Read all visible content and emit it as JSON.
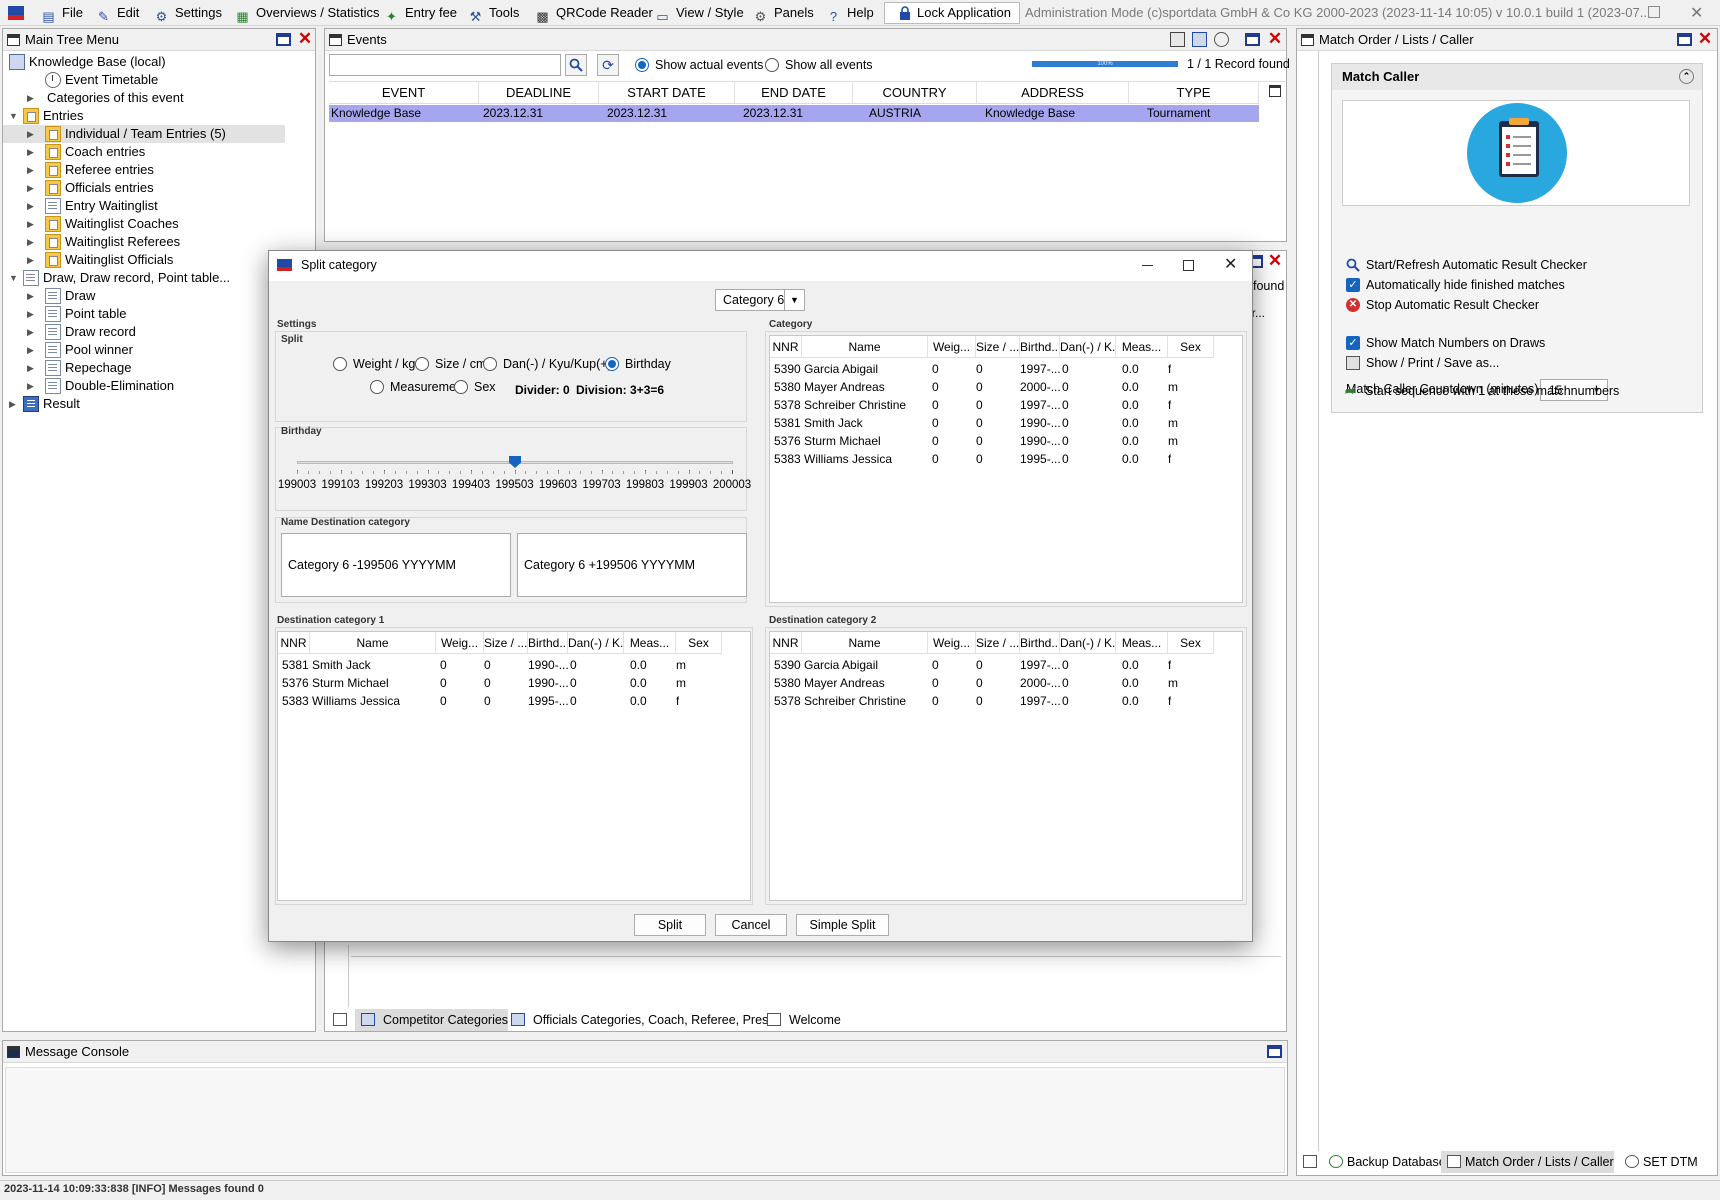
{
  "menu": {
    "items": [
      {
        "label": "File",
        "icon": "file-icon"
      },
      {
        "label": "Edit",
        "icon": "edit-icon"
      },
      {
        "label": "Settings",
        "icon": "gear-icon"
      },
      {
        "label": "Overviews / Statistics",
        "icon": "statistics-icon"
      },
      {
        "label": "Entry fee",
        "icon": "money-icon"
      },
      {
        "label": "Tools",
        "icon": "wrench-icon"
      },
      {
        "label": "QRCode Reader",
        "icon": "qrcode-icon"
      },
      {
        "label": "View / Style",
        "icon": "view-icon"
      },
      {
        "label": "Panels",
        "icon": "panels-icon"
      },
      {
        "label": "Help",
        "icon": "help-icon"
      }
    ],
    "lock_label": "Lock Application",
    "admin_text": "Administration Mode (c)sportdata GmbH & Co KG 2000-2023 (2023-11-14 10:05)  v 10.0.1 build 1 (2023-07..."
  },
  "tree": {
    "title": "Main Tree Menu",
    "items": [
      {
        "label": "Knowledge Base (local)",
        "icon": "kb"
      },
      {
        "label": "Event Timetable",
        "icon": "clock"
      },
      {
        "label": "Categories of this event",
        "icon": ""
      },
      {
        "label": "Entries",
        "icon": "folder"
      },
      {
        "label": "Individual / Team Entries (5)",
        "icon": "folder"
      },
      {
        "label": "Coach entries",
        "icon": "folder"
      },
      {
        "label": "Referee entries",
        "icon": "folder"
      },
      {
        "label": "Officials entries",
        "icon": "folder"
      },
      {
        "label": "Entry Waitinglist",
        "icon": "doc"
      },
      {
        "label": "Waitinglist Coaches",
        "icon": "folder"
      },
      {
        "label": "Waitinglist Referees",
        "icon": "folder"
      },
      {
        "label": "Waitinglist Officials",
        "icon": "folder"
      },
      {
        "label": "Draw, Draw record, Point table...",
        "icon": "doc"
      },
      {
        "label": "Draw",
        "icon": "doc"
      },
      {
        "label": "Point table",
        "icon": "doc"
      },
      {
        "label": "Draw record",
        "icon": "doc"
      },
      {
        "label": "Pool winner",
        "icon": "doc"
      },
      {
        "label": "Repechage",
        "icon": "doc"
      },
      {
        "label": "Double-Elimination",
        "icon": "doc"
      },
      {
        "label": "Result",
        "icon": "res"
      }
    ]
  },
  "events": {
    "title": "Events",
    "search_value": "",
    "radio_actual": "Show actual events",
    "radio_all": "Show all events",
    "progress_label": "100%",
    "progress": 1.0,
    "record_count": "1 / 1 Record found",
    "columns": [
      "EVENT",
      "DEADLINE",
      "START DATE",
      "END DATE",
      "COUNTRY",
      "ADDRESS",
      "TYPE"
    ],
    "rows": [
      [
        "Knowledge Base",
        "2023.12.31",
        "2023.12.31",
        "2023.12.31",
        "AUSTRIA",
        "Knowledge Base",
        "Tournament"
      ]
    ]
  },
  "second_panel": {
    "record_fragment": "found",
    "col_fragment": "or..."
  },
  "dialog": {
    "title": "Split category",
    "category_select": "Category 6",
    "settings_label": "Settings",
    "split_label": "Split",
    "split_options": [
      "Weight / kg",
      "Size / cm",
      "Dan(-) / Kyu/Kup(+)",
      "Birthday",
      "Measurement",
      "Sex"
    ],
    "selected_option": "Birthday",
    "divider_text": "Divider: 0",
    "division_text": "Division: 3+3=6",
    "birthday_label": "Birthday",
    "slider_ticks": [
      "199003",
      "199103",
      "199203",
      "199303",
      "199403",
      "199503",
      "199603",
      "199703",
      "199803",
      "199903",
      "200003"
    ],
    "slider_value": "199506",
    "slider_fraction": 0.5,
    "name_dest_label": "Name Destination category",
    "dest_name_1": "Category 6 -199506 YYYYMM",
    "dest_name_2": "Category 6 +199506 YYYYMM",
    "category_label": "Category",
    "dest1_label": "Destination category 1",
    "dest2_label": "Destination category 2",
    "columns": [
      "NNR",
      "Name",
      "Weig...",
      "Size / ...",
      "Birthd...",
      "Dan(-) / K...",
      "Meas...",
      "Sex"
    ],
    "category_rows": [
      [
        "5390",
        "Garcia Abigail",
        "0",
        "0",
        "1997-...",
        "0",
        "0.0",
        "f"
      ],
      [
        "5380",
        "Mayer Andreas",
        "0",
        "0",
        "2000-...",
        "0",
        "0.0",
        "m"
      ],
      [
        "5378",
        "Schreiber Christine",
        "0",
        "0",
        "1997-...",
        "0",
        "0.0",
        "f"
      ],
      [
        "5381",
        "Smith Jack",
        "0",
        "0",
        "1990-...",
        "0",
        "0.0",
        "m"
      ],
      [
        "5376",
        "Sturm Michael",
        "0",
        "0",
        "1990-...",
        "0",
        "0.0",
        "m"
      ],
      [
        "5383",
        "Williams Jessica",
        "0",
        "0",
        "1995-...",
        "0",
        "0.0",
        "f"
      ]
    ],
    "dest1_rows": [
      [
        "5381",
        "Smith Jack",
        "0",
        "0",
        "1990-...",
        "0",
        "0.0",
        "m"
      ],
      [
        "5376",
        "Sturm Michael",
        "0",
        "0",
        "1990-...",
        "0",
        "0.0",
        "m"
      ],
      [
        "5383",
        "Williams Jessica",
        "0",
        "0",
        "1995-...",
        "0",
        "0.0",
        "f"
      ]
    ],
    "dest2_rows": [
      [
        "5390",
        "Garcia Abigail",
        "0",
        "0",
        "1997-...",
        "0",
        "0.0",
        "f"
      ],
      [
        "5380",
        "Mayer Andreas",
        "0",
        "0",
        "2000-...",
        "0",
        "0.0",
        "m"
      ],
      [
        "5378",
        "Schreiber Christine",
        "0",
        "0",
        "1997-...",
        "0",
        "0.0",
        "f"
      ]
    ],
    "btn_split": "Split",
    "btn_cancel": "Cancel",
    "btn_simple": "Simple Split"
  },
  "match_caller": {
    "panel_title": "Match Order / Lists / Caller",
    "section_title": "Match Caller",
    "start_refresh": "Start/Refresh Automatic Result Checker",
    "auto_hide": "Automatically hide finished matches",
    "stop_checker": "Stop Automatic Result Checker",
    "show_numbers": "Show Match Numbers on Draws",
    "show_print": "Show / Print / Save as...",
    "countdown_label": "Match Caller Countdown (minutes)",
    "countdown_value": "15",
    "start_sequence": "Start sequence with 1 at these matchnumbers"
  },
  "bottom_tabs": [
    "Competitor Categories",
    "Officials Categories, Coach, Referee, Press",
    "Welcome"
  ],
  "right_tabs": [
    "Backup Database",
    "Match Order / Lists / Caller",
    "SET DTM"
  ],
  "console": {
    "title": "Message Console"
  },
  "status": "2023-11-14 10:09:33:838 [INFO] Messages found 0",
  "colors": {
    "selected_row": "#a5a5f0",
    "accent": "#1565c0",
    "close": "#d40000",
    "caller_icon": "#29a8e0"
  }
}
